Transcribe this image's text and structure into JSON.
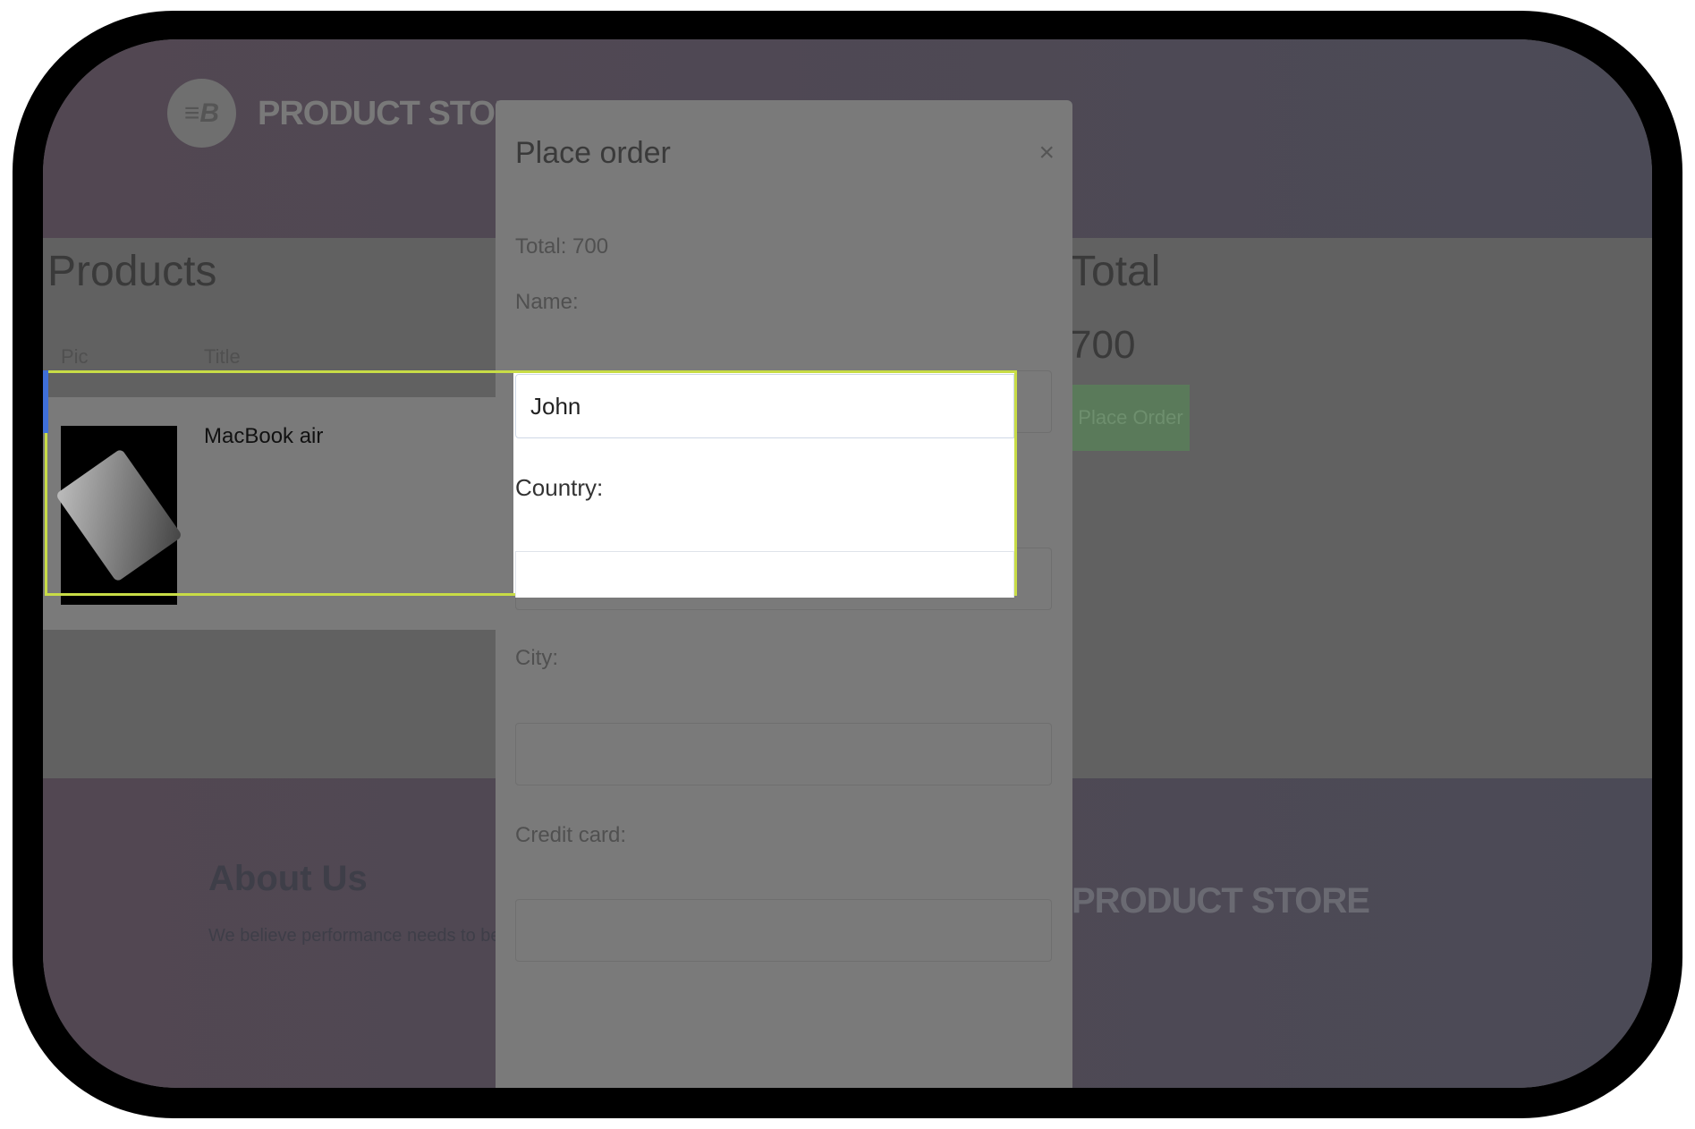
{
  "navbar": {
    "brand": "PRODUCT STORE",
    "logo_letter": "≡B"
  },
  "cart": {
    "heading": "Products",
    "columns": [
      "Pic",
      "Title"
    ],
    "rows": [
      {
        "title": "MacBook air"
      }
    ],
    "total_heading": "Total",
    "total_value": "700",
    "place_order_label": "Place Order"
  },
  "modal": {
    "title": "Place order",
    "close": "×",
    "total_text": "Total: 700",
    "name_label": "Name:",
    "name_value": "John",
    "country_label": "Country:",
    "country_value": "",
    "city_label": "City:",
    "card_label": "Credit card:"
  },
  "footer": {
    "about_heading": "About Us",
    "about_text": "We believe performance needs to be v",
    "brand": "PRODUCT STORE"
  },
  "colors": {
    "highlight": "#c8dc46",
    "overlay": "#606060"
  }
}
